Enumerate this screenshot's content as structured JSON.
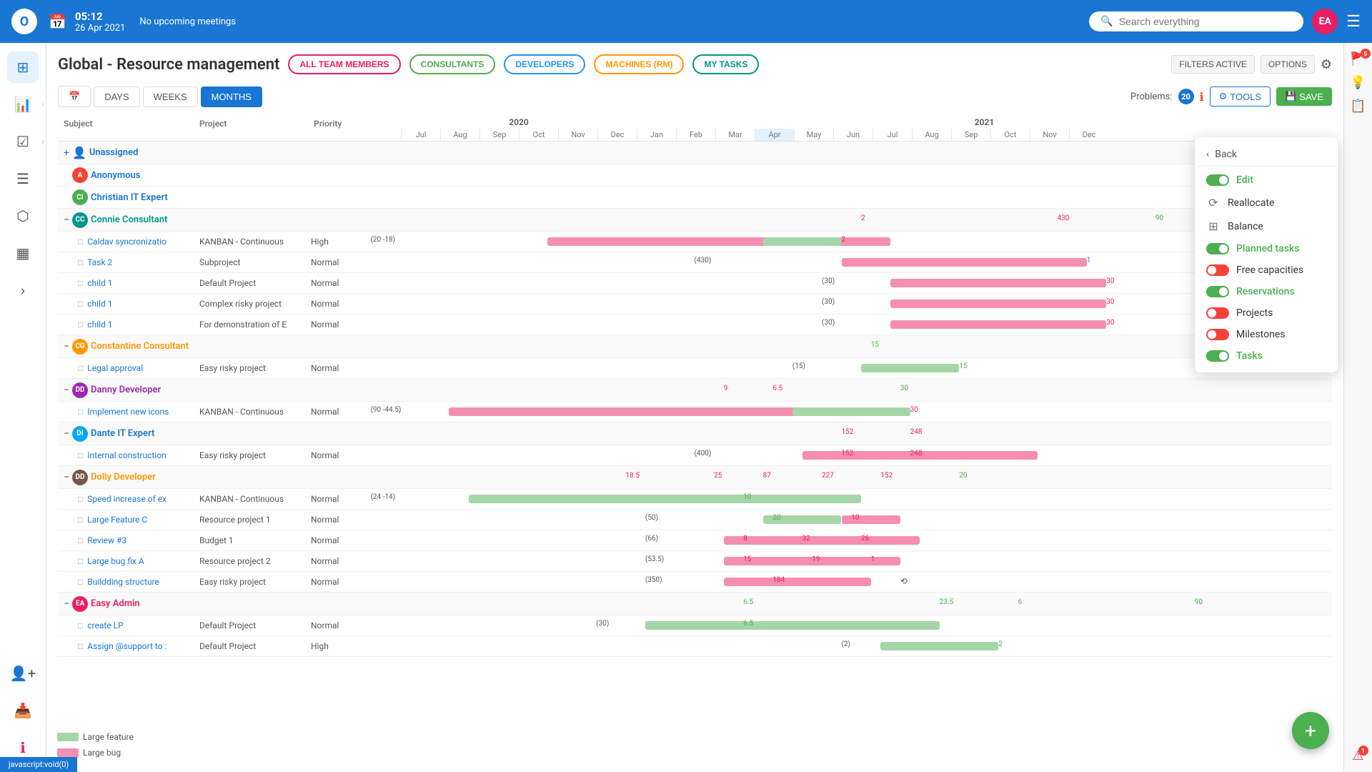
{
  "topbar": {
    "time": "05:12",
    "date": "26 Apr 2021",
    "meetings": "No upcoming meetings",
    "search_placeholder": "Search everything",
    "avatar_initials": "EA",
    "logo_text": "O"
  },
  "page": {
    "title": "Global - Resource management"
  },
  "filters": [
    {
      "label": "ALL TEAM MEMBERS",
      "color": "pink"
    },
    {
      "label": "CONSULTANTS",
      "color": "green"
    },
    {
      "label": "DEVELOPERS",
      "color": "blue"
    },
    {
      "label": "MACHINES (RM)",
      "color": "orange"
    },
    {
      "label": "MY TASKS",
      "color": "teal"
    }
  ],
  "header_buttons": {
    "filters_active": "FILTERS ACTIVE",
    "options": "OPTIONS",
    "tools": "TOOLS",
    "save": "SAVE"
  },
  "view_buttons": [
    {
      "label": "DAYS",
      "active": false
    },
    {
      "label": "WEEKS",
      "active": false
    },
    {
      "label": "MONTHS",
      "active": true
    }
  ],
  "problems": {
    "label": "Problems:",
    "count": "20"
  },
  "columns": {
    "subject": "Subject",
    "project": "Project",
    "priority": "Priority"
  },
  "years": [
    "2020",
    "2021"
  ],
  "months_2020": [
    "Jul",
    "Aug",
    "Sep",
    "Oct",
    "Nov",
    "Dec"
  ],
  "months_2021": [
    "Jan",
    "Feb",
    "Mar",
    "Apr",
    "May",
    "Jun",
    "Jul",
    "Aug",
    "Sep",
    "Oct",
    "Nov",
    "Dec"
  ],
  "rows": [
    {
      "type": "group",
      "name": "Unassigned",
      "avatar_text": "👤",
      "avatar_color": "none"
    },
    {
      "type": "person",
      "name": "Anonymous",
      "avatar": "A",
      "avatar_color": "red"
    },
    {
      "type": "person",
      "name": "Christian IT Expert",
      "avatar": "CI",
      "avatar_color": "green"
    },
    {
      "type": "person",
      "name": "Connie Consultant",
      "avatar": "CC",
      "avatar_color": "teal",
      "numbers": "2 | 430 90"
    },
    {
      "type": "task",
      "subject": "Caldav syncronizatio",
      "project": "KANBAN - Continuous",
      "priority": "High",
      "offset": "(20 -18)"
    },
    {
      "type": "task",
      "subject": "Task 2",
      "project": "Subproject",
      "priority": "Normal",
      "offset": "(430)"
    },
    {
      "type": "task",
      "subject": "child 1",
      "project": "Default Project",
      "priority": "Normal",
      "offset": "(30)",
      "right_num": "30"
    },
    {
      "type": "task",
      "subject": "child 1",
      "project": "Complex risky project",
      "priority": "Normal",
      "offset": "(30)",
      "right_num": "30"
    },
    {
      "type": "task",
      "subject": "child 1",
      "project": "For demonstration of E",
      "priority": "Normal",
      "offset": "(30)",
      "right_num": "30"
    },
    {
      "type": "person",
      "name": "Constantine Consultant",
      "avatar": "CG",
      "avatar_color": "orange",
      "numbers": "15"
    },
    {
      "type": "task",
      "subject": "Legal approval",
      "project": "Easy risky project",
      "priority": "Normal",
      "offset": "(15)",
      "right_num": "15"
    },
    {
      "type": "person",
      "name": "Danny Developer",
      "avatar": "DD",
      "avatar_color": "purple",
      "numbers": "9 6.5 | 30"
    },
    {
      "type": "task",
      "subject": "Implement new icons",
      "project": "KANBAN - Continuous",
      "priority": "Normal",
      "offset": "(90 -44.5)",
      "right_num": "30"
    },
    {
      "type": "person",
      "name": "Dante IT Expert",
      "avatar": "DI",
      "avatar_color": "light-blue",
      "numbers": "152 248"
    },
    {
      "type": "task",
      "subject": "Internal construction",
      "project": "Easy risky project",
      "priority": "Normal",
      "offset": "(400)",
      "right_num": "152 248"
    },
    {
      "type": "person",
      "name": "Dolly Developer",
      "avatar": "DD",
      "avatar_color": "brown",
      "numbers": "18.5 25 87 227 152 | 20"
    },
    {
      "type": "task",
      "subject": "Speed increase of ex",
      "project": "KANBAN - Continuous",
      "priority": "Normal",
      "offset": "(24 -14)",
      "right_num": "10"
    },
    {
      "type": "task",
      "subject": "Large Feature C",
      "project": "Resource project 1",
      "priority": "Normal",
      "offset": "(50)",
      "right_num": "20 10"
    },
    {
      "type": "task",
      "subject": "Review #3",
      "project": "Budget 1",
      "priority": "Normal",
      "offset": "(66)",
      "right_num": "8 32 26"
    },
    {
      "type": "task",
      "subject": "Large bug fix A",
      "project": "Resource project 2",
      "priority": "Normal",
      "offset": "(53.5)",
      "right_num": "15 19 1"
    },
    {
      "type": "task",
      "subject": "Buildding structure",
      "project": "Easy risky project",
      "priority": "Normal",
      "offset": "(350)",
      "right_num": "184"
    },
    {
      "type": "person",
      "name": "Easy Admin",
      "avatar": "EA",
      "avatar_color": "ea",
      "numbers": "6.5 | 23.5 6 | 90"
    },
    {
      "type": "task",
      "subject": "create LP",
      "project": "Default Project",
      "priority": "Normal",
      "offset": "(30)"
    },
    {
      "type": "task",
      "subject": "Assign @support to :",
      "project": "Default Project",
      "priority": "High",
      "offset": "(2)",
      "right_num": "2"
    }
  ],
  "dropdown": {
    "back_label": "Back",
    "items": [
      {
        "label": "Edit",
        "toggle": "on",
        "icon": "edit"
      },
      {
        "label": "Reallocate",
        "toggle": null,
        "icon": "reallocate"
      },
      {
        "label": "Balance",
        "toggle": null,
        "icon": "balance"
      },
      {
        "label": "Planned tasks",
        "toggle": "on",
        "icon": "planned",
        "active": true
      },
      {
        "label": "Free capacities",
        "toggle": "off",
        "icon": "free"
      },
      {
        "label": "Reservations",
        "toggle": "on",
        "icon": "reservations",
        "active": true
      },
      {
        "label": "Projects",
        "toggle": "off",
        "icon": "projects"
      },
      {
        "label": "Milestones",
        "toggle": "off",
        "icon": "milestones"
      },
      {
        "label": "Tasks",
        "toggle": "on",
        "icon": "tasks"
      }
    ]
  },
  "legend": {
    "large_feature": "Large feature",
    "large_bug": "Large bug"
  },
  "sidebar_icons": [
    "grid",
    "chart",
    "check",
    "list",
    "box",
    "bolt"
  ],
  "right_sidebar_icons": [
    "flag",
    "bulb",
    "list-check"
  ],
  "status_bar": "javascript:void(0)"
}
